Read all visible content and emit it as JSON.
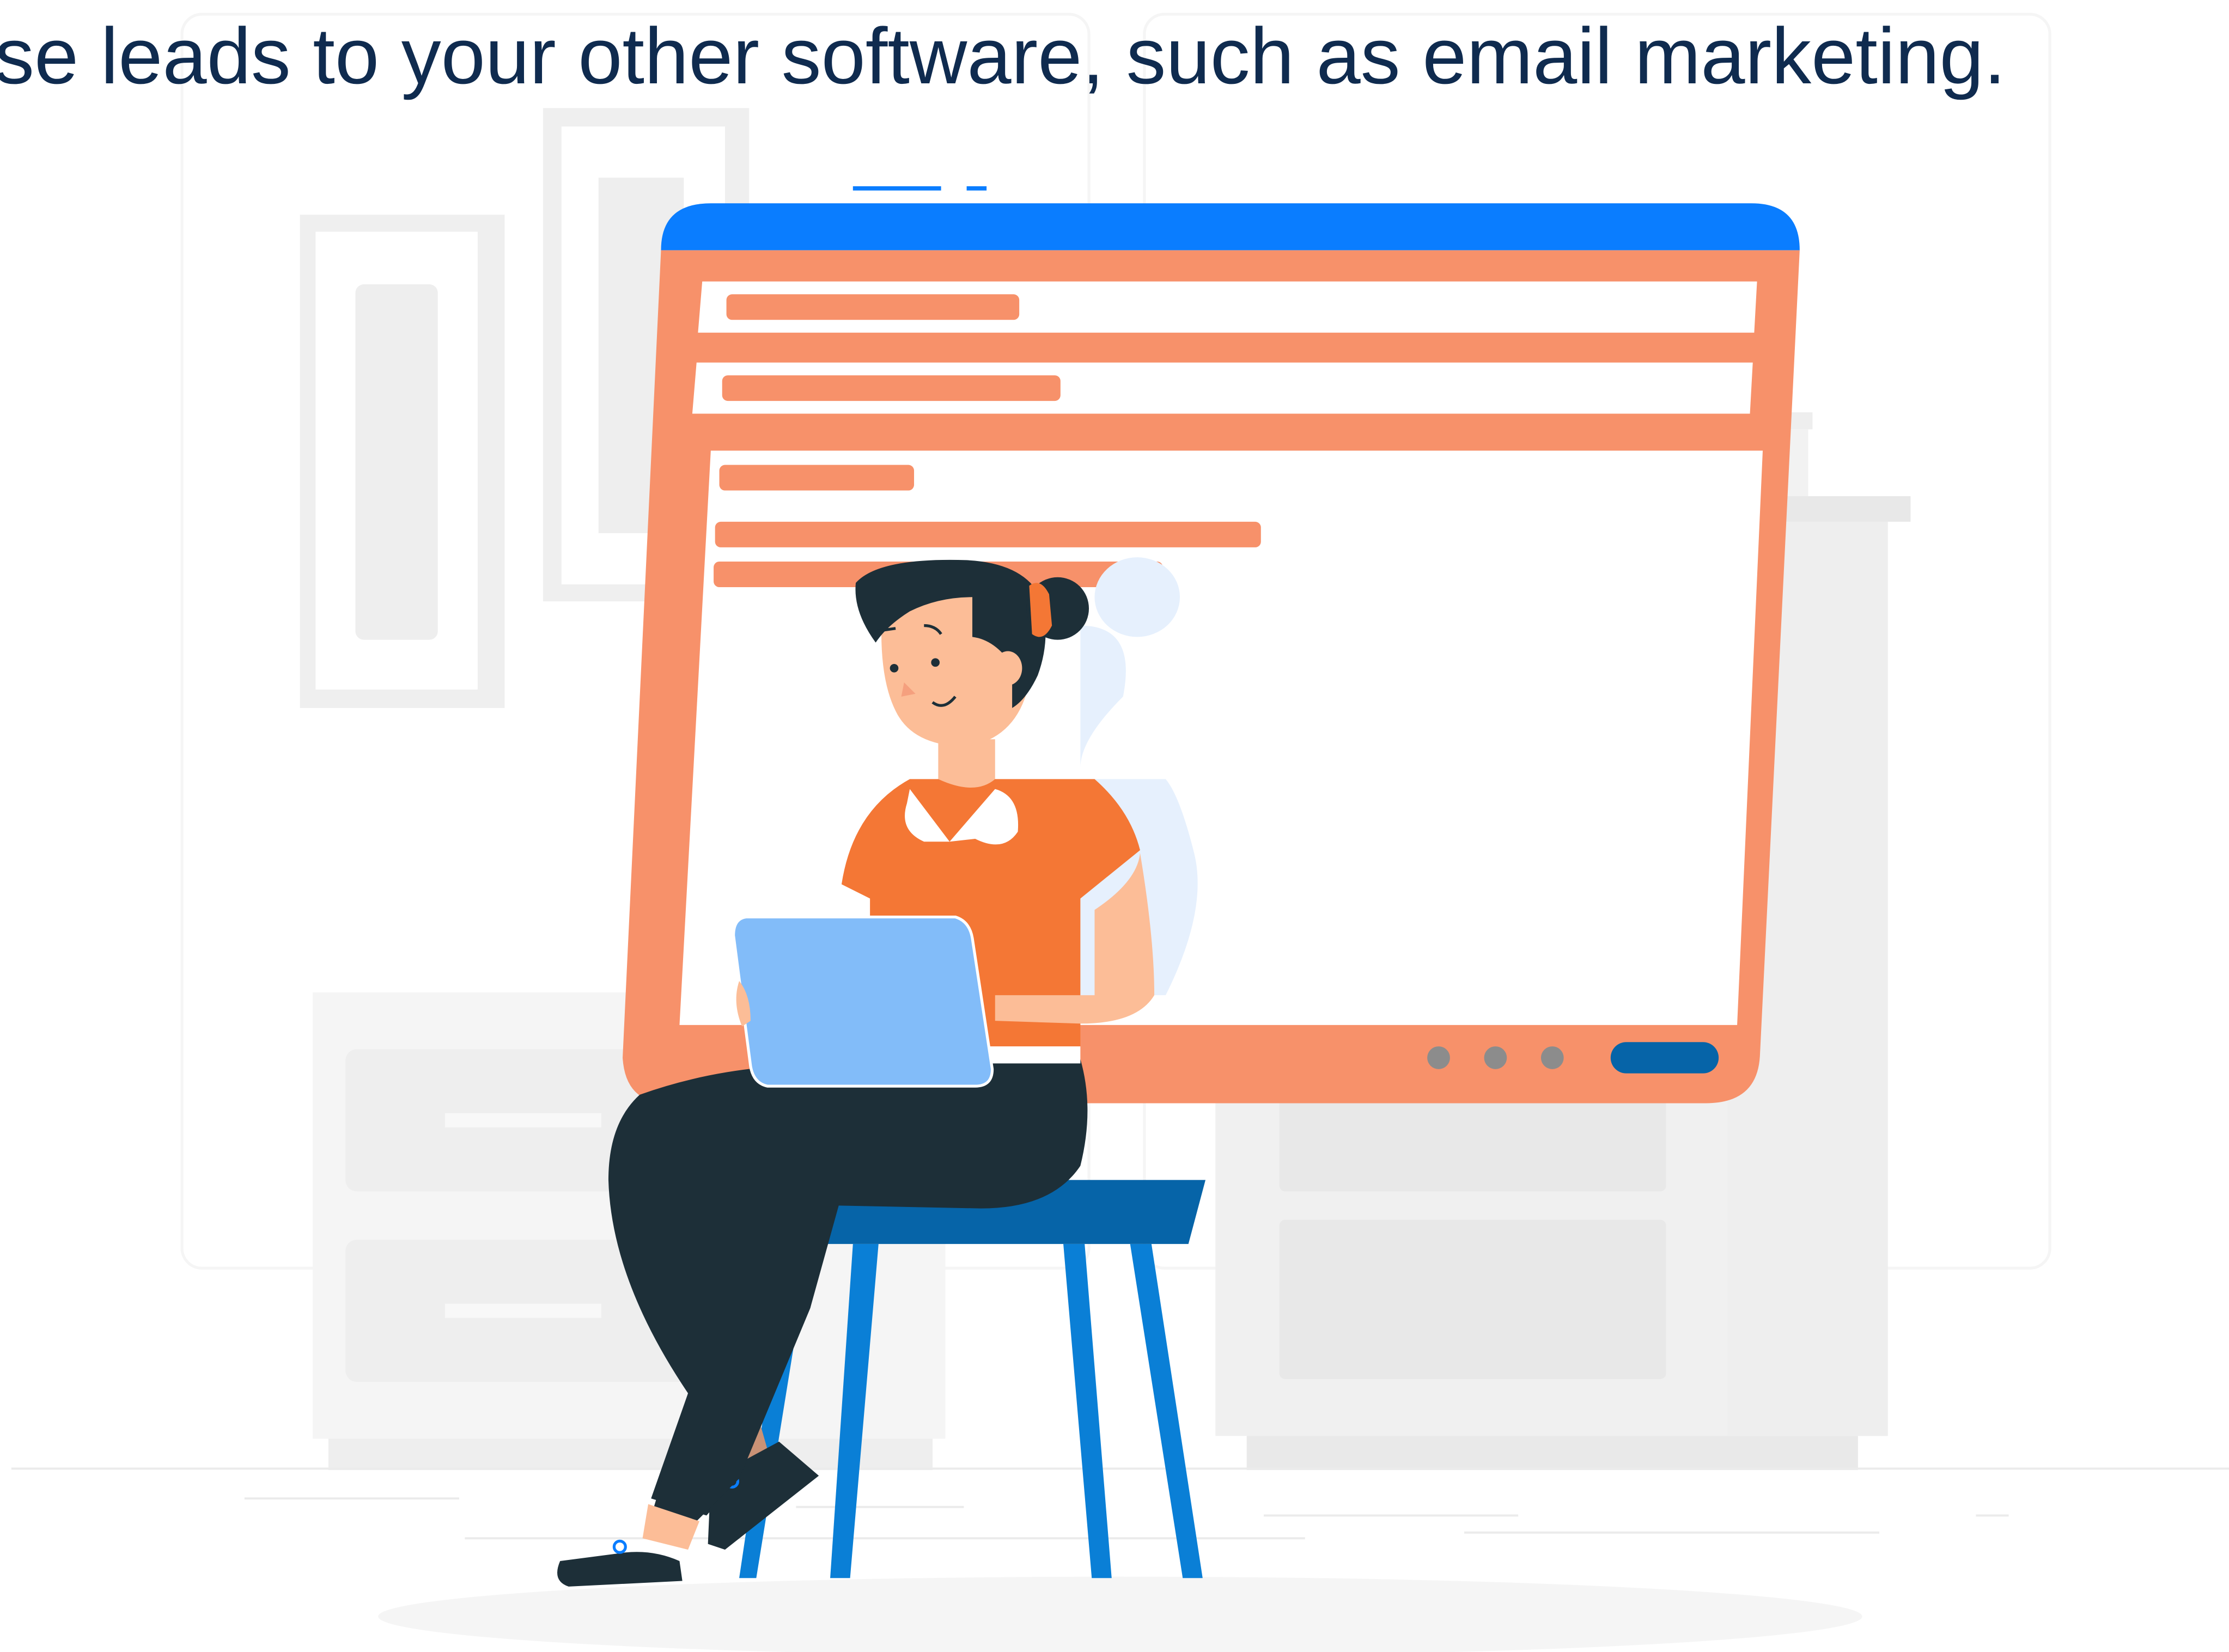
{
  "headline": {
    "text": "se leads to your other software, such as email marketing."
  },
  "illustration": {
    "colors": {
      "window_frame": "#f7916a",
      "window_titlebar": "#0a7dff",
      "window_button": "#0664a8",
      "window_dots": "#8c8c8c",
      "panel_white": "#ffffff",
      "shirt": "#f47735",
      "skin": "#fcbd97",
      "hair": "#1d2f38",
      "pants": "#1d2f38",
      "tablet": "#82bcf9",
      "stool_seat": "#0664a8",
      "stool_legs": "#0a7fd6",
      "background_furniture": "#eeeeee",
      "text_color": "#0f2b4f"
    },
    "icons": [
      "browser-window-icon",
      "woman-with-tablet-icon",
      "stool-icon",
      "bookshelf-icon",
      "picture-frame-icon"
    ]
  }
}
